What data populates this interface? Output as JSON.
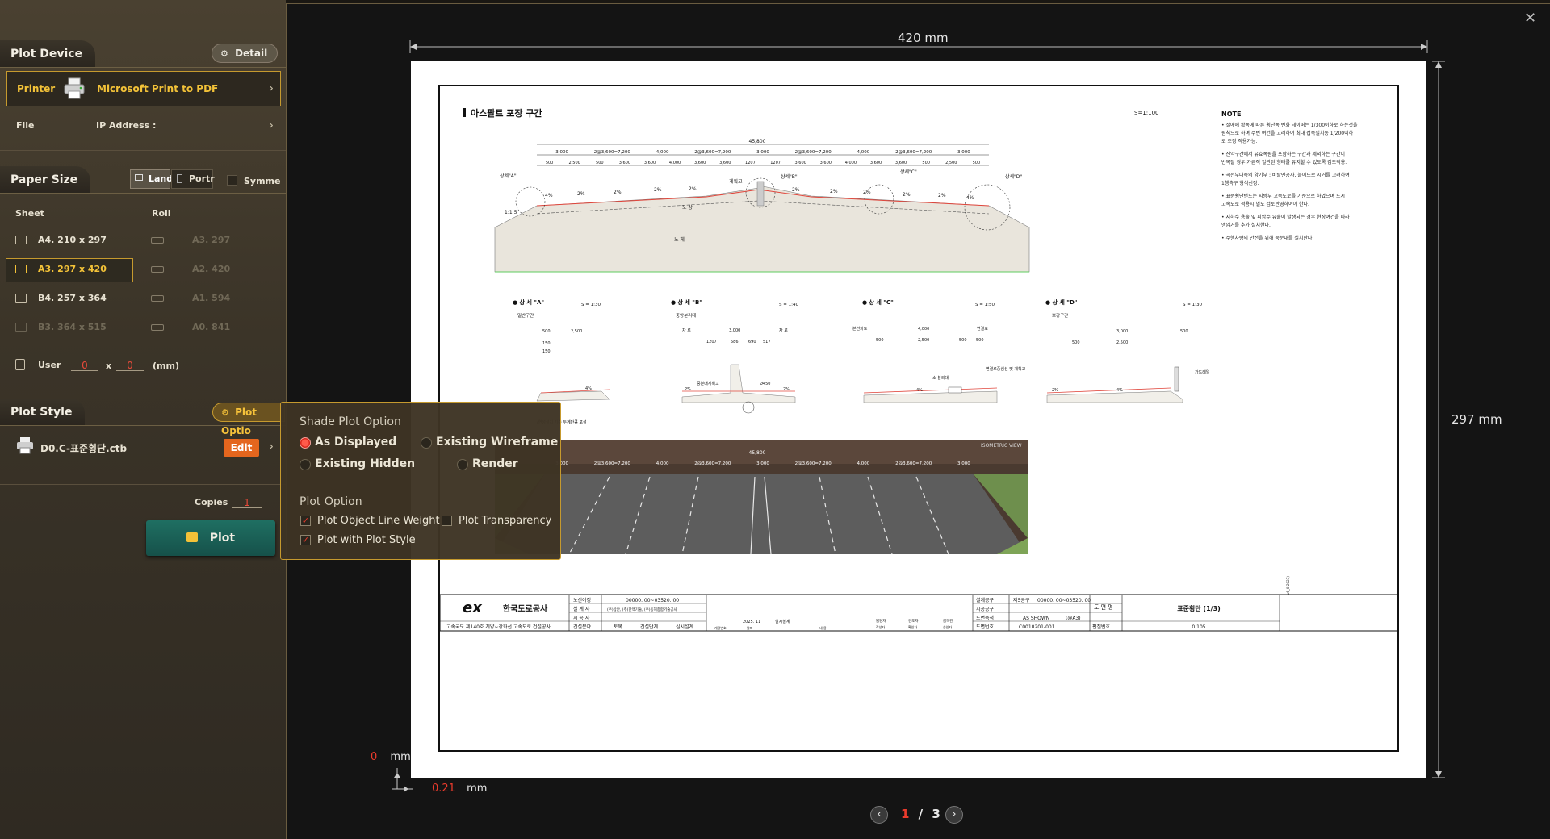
{
  "plot_device": {
    "title": "Plot Device",
    "detail_label": "Detail",
    "printer_label": "Printer",
    "printer_name": "Microsoft Print to PDF",
    "file_label": "File",
    "ip_label": "IP Address :"
  },
  "paper_size": {
    "title": "Paper Size",
    "land_label": "Land",
    "portrait_label": "Portr",
    "symmetric_label": "Symme",
    "sheet_header": "Sheet",
    "roll_header": "Roll",
    "sheets": [
      "A4. 210 x 297",
      "A3. 297 x 420",
      "B4. 257 x 364",
      "B3. 364 x 515"
    ],
    "rolls": [
      "A3. 297",
      "A2. 420",
      "A1. 594",
      "A0. 841"
    ],
    "selected_sheet": "A3. 297 x 420",
    "user_label": "User",
    "user_w": "0",
    "user_x": "x",
    "user_h": "0",
    "user_unit": "(mm)"
  },
  "plot_style": {
    "title": "Plot Style",
    "plot_option_label": "Plot Optio",
    "ctb_name": "D0.C-표준횡단.ctb",
    "edit_label": "Edit",
    "copies_label": "Copies",
    "copies_value": "1",
    "plot_button": "Plot"
  },
  "popup": {
    "shade_title": "Shade Plot Option",
    "as_displayed": "As Displayed",
    "existing_wireframe": "Existing Wireframe",
    "existing_hidden": "Existing Hidden",
    "render": "Render",
    "selected_shade": "As Displayed",
    "plot_option_title": "Plot Option",
    "line_weight": "Plot Object Line Weight",
    "transparency": "Plot Transparency",
    "with_style": "Plot with Plot Style",
    "line_weight_checked": true,
    "transparency_checked": false,
    "with_style_checked": true
  },
  "preview": {
    "width_label": "420",
    "height_label": "297",
    "unit": "mm",
    "offset_y": "0",
    "offset_x": "0.21",
    "current_page": "1",
    "page_sep": "/",
    "total_pages": "3"
  },
  "drawing": {
    "section_title": "아스팔트 포장 구간",
    "scale_main": "S=1:100",
    "note_title": "NOTE",
    "notes": [
      "• 절에에 확폭에 따른 횡단폭 변화 테이퍼는 1/300이하로 하는것을",
      "  원칙으로 하며 주변 여건을 고려하여 최대 접속설치동 1/200이하",
      "  로 조정 적용가능.",
      "• 산악구간에서 유효폭원을 포함하는 구간과 제외하는 구간이",
      "  반복될 경우 가급적 일관된 형태를 유지할 수 있도록 검토적용.",
      "• 곡선부내측의 양기부 : 비탈면공사, 늘어뜨로 시거를 고려하여",
      "  1행측구 형식선정.",
      "• 표준횡단변도는 지방부 고속도로를 기준으로 하였으며 도시",
      "  고속도로 적용시 별도 검토반영하여야 한다.",
      "• 지하수 용출 및 피암수 유출이 발생되는 경우 현장여건을 따라",
      "  맹암거를 추가 설치한다.",
      "• 주행차량의 안전을 위해 중분대를 설치한다."
    ],
    "dims_top": [
      "45,800"
    ],
    "dims_row1": [
      "3,000",
      "2@3,600=7,200",
      "4,000",
      "2@3,600=7,200",
      "3,000",
      "2@3,600=7,200",
      "4,000",
      "2@3,600=7,200",
      "3,000"
    ],
    "dims_row2": [
      "500",
      "2,500",
      "500",
      "3,600",
      "3,600",
      "4,000",
      "3,600",
      "3,600",
      "1207",
      "1207",
      "3,600",
      "3,600",
      "4,000",
      "3,600",
      "3,600",
      "500",
      "2,500",
      "500"
    ],
    "detail_a": "상세\"A\"",
    "detail_b": "상세\"B\"",
    "detail_c": "상세\"C\"",
    "detail_d": "상세\"D\"",
    "label_gyehoekgo": "계획고",
    "label_nosang": "노 상",
    "label_noche": "노 체",
    "slope_11": "1:1.5",
    "pct_4": "4%",
    "pct_2": "2%",
    "detail_a_title": "● 상 세 \"A\"",
    "detail_a_scale": "S = 1:30",
    "detail_a_sub": "일반구간",
    "detail_b_title": "● 상 세 \"B\"",
    "detail_b_scale": "S = 1:40",
    "detail_b_sub": "중앙분리대",
    "detail_c_title": "● 상 세 \"C\"",
    "detail_c_scale": "S = 1:50",
    "detail_d_title": "● 상 세 \"D\"",
    "detail_d_scale": "S = 1:30",
    "detail_d_sub": "보강구간",
    "det_a_dims": [
      "500",
      "2,500",
      "150",
      "150"
    ],
    "det_b_dims": [
      "차 로",
      "3,000",
      "차 로",
      "1207",
      "586",
      "690",
      "517"
    ],
    "det_b_labels": [
      "중분대계획고",
      "Ø450"
    ],
    "det_c_dims": [
      "본선차도",
      "4,000",
      "연결로",
      "500",
      "2,500",
      "500",
      "500"
    ],
    "det_c_labels": [
      "소 분리대",
      "연결로중심선 및 계획고"
    ],
    "det_d_dims": [
      "3,000",
      "500",
      "500",
      "2,500"
    ],
    "det_d_labels": [
      "가드레일"
    ],
    "det_a_note": "/연성설치 기층 두께만큼 포설",
    "isometric": "ISOMETRIC VIEW",
    "title_block": {
      "logo_text": "한국도로공사",
      "project": "고속국도 제140호 계양~강화선 고속도로 건설공사",
      "rows_left_labels": [
        "노선이정",
        "설 계 사",
        "시 공 사",
        "건설분야"
      ],
      "rows_left_values": [
        "00000. 00~03520. 00",
        "(주)삼안, (주)한맥기술, (주)동해종합기술공사",
        "",
        ""
      ],
      "bottom_cells": [
        "토목",
        "건설단계",
        "실시설계"
      ],
      "rev_cells": [
        "개정번호",
        "2025. 11",
        "날짜",
        "실시설계",
        "내 용"
      ],
      "sign_labels": [
        "담당자",
        "작성자",
        "검토자",
        "확인자",
        "감독관",
        "승인자"
      ],
      "right_labels": [
        "설계공구",
        "시공공구",
        "도면축척",
        "도면번호"
      ],
      "right_values": [
        "제5공구",
        "",
        "AS SHOWN",
        "C0010201-001"
      ],
      "right_values2": [
        "00000. 00~03520. 00",
        "",
        "(@A3)",
        ""
      ],
      "drawing_name_label": "도 면 명",
      "drawing_name": "표준횡단 (1/3)",
      "edit_no_label": "편철번호",
      "edit_no": "0.105",
      "side_code": "v6_0(2023)"
    }
  }
}
